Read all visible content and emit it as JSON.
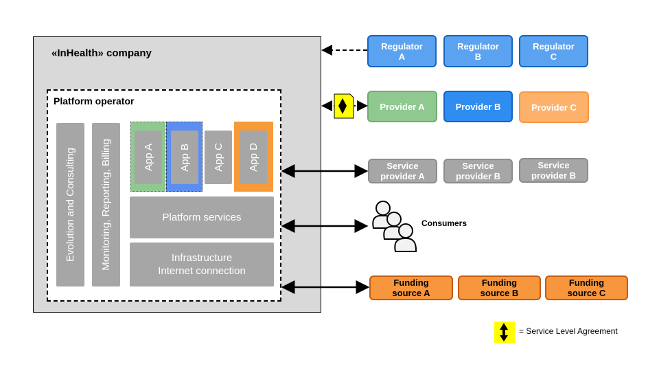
{
  "company": {
    "title": "«InHealth»  company"
  },
  "operator": {
    "title": "Platform  operator",
    "columns": [
      "Evolution and Consulting",
      "Monitoring, Reporting, Billing"
    ],
    "apps": [
      {
        "label": "App A",
        "color": "#8fc98f"
      },
      {
        "label": "App B",
        "color": "#5b8ef0"
      },
      {
        "label": "App C",
        "color": ""
      },
      {
        "label": "App D",
        "color": "#f79a38"
      }
    ],
    "platform_services": "Platform  services",
    "infrastructure": [
      "Infrastructure",
      "Internet  connection"
    ]
  },
  "regulators": [
    [
      "Regulator",
      "A"
    ],
    [
      "Regulator",
      "B"
    ],
    [
      "Regulator",
      "C"
    ]
  ],
  "providers": [
    {
      "label": "Provider A",
      "color": "#8fc98f"
    },
    {
      "label": "Provider B",
      "color": "#2f8cf0"
    },
    {
      "label": "Provider C",
      "color": "#fdb16a"
    }
  ],
  "service_providers": [
    [
      "Service",
      "provider A"
    ],
    [
      "Service",
      "provider B"
    ],
    [
      "Service",
      "provider B"
    ]
  ],
  "consumers": {
    "label": "Consumers",
    "icon": "people-icon"
  },
  "funding": [
    [
      "Funding",
      "source A"
    ],
    [
      "Funding",
      "source B"
    ],
    [
      "Funding",
      "source C"
    ]
  ],
  "legend": {
    "icon": "sla-icon",
    "text": "= Service  Level  Agreement",
    "color": "#ffff00"
  }
}
